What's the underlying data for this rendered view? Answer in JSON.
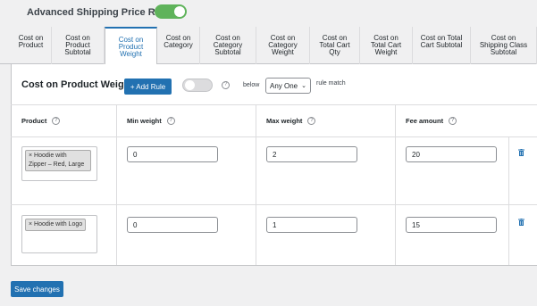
{
  "header": {
    "title": "Advanced Shipping Price Rules",
    "enabled": true
  },
  "tabs": [
    {
      "label": "Cost on\nProduct"
    },
    {
      "label": "Cost on\nProduct\nSubtotal"
    },
    {
      "label": "Cost on\nProduct\nWeight"
    },
    {
      "label": "Cost on\nCategory"
    },
    {
      "label": "Cost on\nCategory\nSubtotal"
    },
    {
      "label": "Cost on\nCategory\nWeight"
    },
    {
      "label": "Cost on\nTotal Cart\nQty"
    },
    {
      "label": "Cost on\nTotal Cart\nWeight"
    },
    {
      "label": "Cost on Total\nCart Subtotal"
    },
    {
      "label": "Cost on\nShipping Class\nSubtotal"
    }
  ],
  "section": {
    "title": "Cost on Product Weight",
    "add_rule_label": "+ Add Rule",
    "toggle_on": false,
    "below_label": "below",
    "match_value": "Any One",
    "rule_match_label": "rule match"
  },
  "table": {
    "headers": [
      "Product",
      "Min weight",
      "Max weight",
      "Fee amount"
    ],
    "rows": [
      {
        "product": "× Hoodie with\nZipper – Red, Large",
        "min": "0",
        "max": "2",
        "fee": "20"
      },
      {
        "product": "× Hoodie with Logo",
        "min": "0",
        "max": "1",
        "fee": "15"
      }
    ]
  },
  "footer": {
    "save_label": "Save changes"
  },
  "colors": {
    "accent": "#2271b1",
    "toggle_on": "#5fb35b",
    "delete": "#2271b1"
  }
}
